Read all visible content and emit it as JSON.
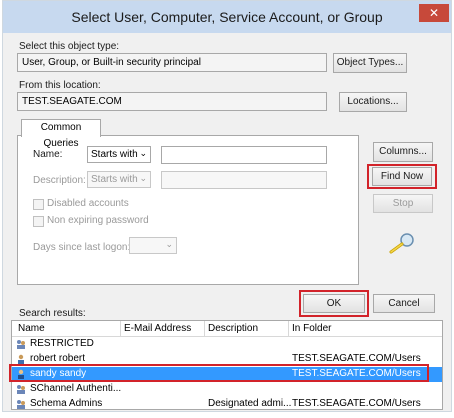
{
  "window": {
    "title": "Select User, Computer, Service Account, or Group",
    "close_glyph": "✕"
  },
  "object_type": {
    "label": "Select this object type:",
    "value": "User, Group, or Built-in security principal",
    "button": "Object Types..."
  },
  "location": {
    "label": "From this location:",
    "value": "TEST.SEAGATE.COM",
    "button": "Locations..."
  },
  "common_queries": {
    "tab": "Common Queries",
    "name_label": "Name:",
    "name_mode": "Starts with",
    "description_label": "Description:",
    "description_mode": "Starts with",
    "disabled_accounts": "Disabled accounts",
    "non_expiring": "Non expiring password",
    "days_since_logon": "Days since last logon:"
  },
  "side_buttons": {
    "columns": "Columns...",
    "find_now": "Find Now",
    "stop": "Stop"
  },
  "dialog_buttons": {
    "ok": "OK",
    "cancel": "Cancel"
  },
  "results": {
    "label": "Search results:",
    "columns": [
      "Name",
      "E-Mail Address",
      "Description",
      "In Folder"
    ],
    "rows": [
      {
        "name": "RESTRICTED",
        "email": "",
        "description": "",
        "folder": ""
      },
      {
        "name": "robert robert",
        "email": "",
        "description": "",
        "folder": "TEST.SEAGATE.COM/Users"
      },
      {
        "name": "sandy sandy",
        "email": "",
        "description": "",
        "folder": "TEST.SEAGATE.COM/Users"
      },
      {
        "name": "SChannel Authenti...",
        "email": "",
        "description": "",
        "folder": ""
      },
      {
        "name": "Schema Admins",
        "email": "",
        "description": "Designated admi...",
        "folder": "TEST.SEAGATE.COM/Users"
      }
    ]
  },
  "colors": {
    "highlight": "#d2232a",
    "selection": "#3399ff",
    "titlebar": "#c7d9ef"
  }
}
